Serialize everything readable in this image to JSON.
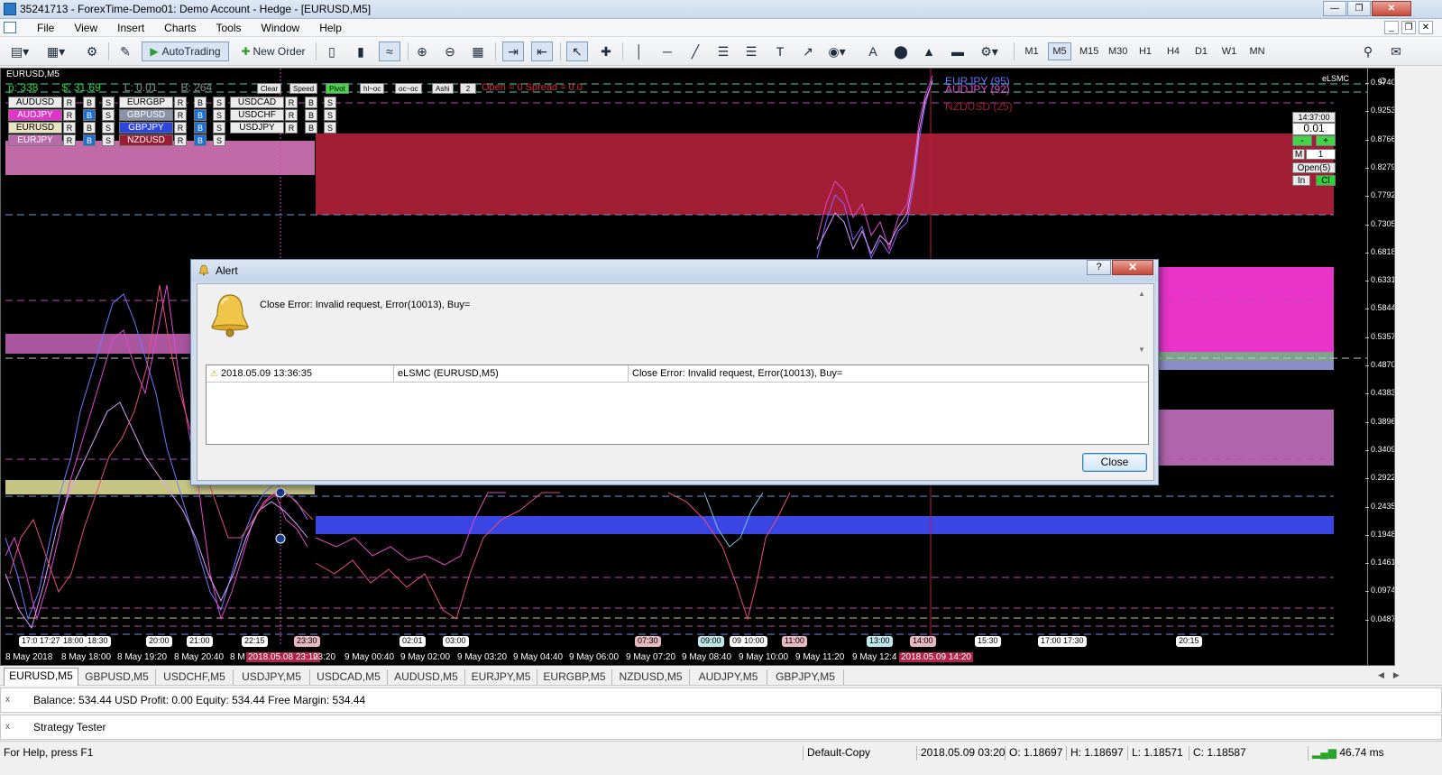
{
  "window": {
    "title": "35241713 - ForexTime-Demo01: Demo Account - Hedge - [EURUSD,M5]"
  },
  "menu": [
    "File",
    "View",
    "Insert",
    "Charts",
    "Tools",
    "Window",
    "Help"
  ],
  "toolbar": {
    "autotrading": "AutoTrading",
    "new_order": "New Order",
    "timeframes": [
      "M1",
      "M5",
      "M15",
      "M30",
      "H1",
      "H4",
      "D1",
      "W1",
      "MN"
    ],
    "active_timeframe": "M5"
  },
  "chart": {
    "symbol": "EURUSD,M5",
    "indicator": "eLSMC",
    "stats": {
      "p": "p: 338",
      "s": "$: 31.69",
      "l": "L: 0.01",
      "b": "B: 264"
    },
    "controls": [
      "Clear",
      "Speed",
      "Pivot",
      "hl~oc",
      "oc~oc",
      "Ashi"
    ],
    "ashi_value": "2",
    "open_spread": "Open = 0  Spread = 0.0",
    "pairs": [
      [
        "AUDUSD",
        "EURGBP",
        "USDCAD"
      ],
      [
        "AUDJPY",
        "GBPUSD",
        "USDCHF"
      ],
      [
        "EURUSD",
        "GBPJPY",
        "USDJPY"
      ],
      [
        "EURJPY",
        "NZDUSD",
        ""
      ]
    ],
    "button_letters": [
      "R",
      "B",
      "S"
    ],
    "legend_top": [
      "EURJPY (95)",
      "AUDJPY (92)",
      "NZDUSD (25)"
    ],
    "side_panel": {
      "time": "14:37:00",
      "lot": "0.01",
      "minus": "-",
      "plus": "+",
      "m_label": "M",
      "m_value": "1",
      "open": "Open(5)",
      "in": "In",
      "cl": "Cl"
    },
    "yaxis": [
      "0.97400",
      "0.92530",
      "0.87660",
      "0.82790",
      "0.77920",
      "0.73050",
      "0.68180",
      "0.63310",
      "0.58440",
      "0.53570",
      "0.48700",
      "0.43830",
      "0.38960",
      "0.34090",
      "0.29220",
      "0.24350",
      "0.19480",
      "0.14610",
      "0.09740",
      "0.04870"
    ],
    "time_markers": [
      {
        "t": "17:0",
        "c": "w"
      },
      {
        "t": "17:27",
        "c": "w"
      },
      {
        "t": "18:00",
        "c": "w"
      },
      {
        "t": "18:30",
        "c": "w"
      },
      {
        "t": "20:00",
        "c": "w"
      },
      {
        "t": "21:00",
        "c": "w"
      },
      {
        "t": "22:15",
        "c": "w"
      },
      {
        "t": "23:30",
        "c": "r"
      },
      {
        "t": "02:01",
        "c": "w"
      },
      {
        "t": "03:00",
        "c": "w"
      },
      {
        "t": "07:30",
        "c": "r"
      },
      {
        "t": "09:00",
        "c": "c"
      },
      {
        "t": "09",
        "c": "w"
      },
      {
        "t": "10:00",
        "c": "w"
      },
      {
        "t": "11:00",
        "c": "r"
      },
      {
        "t": "13:00",
        "c": "c"
      },
      {
        "t": "14:00",
        "c": "r"
      },
      {
        "t": "15:30",
        "c": "w"
      },
      {
        "t": "17:00",
        "c": "w"
      },
      {
        "t": "17:30",
        "c": "w"
      },
      {
        "t": "20:15",
        "c": "w"
      }
    ],
    "xaxis": [
      "8 May 2018",
      "8 May 18:00",
      "8 May 19:20",
      "8 May 20:40",
      "8 M",
      "2018.05.08 23:10",
      "23:20",
      "9 May 00:40",
      "9 May 02:00",
      "9 May 03:20",
      "9 May 04:40",
      "9 May 06:00",
      "9 May 07:20",
      "9 May 08:40",
      "9 May 10:00",
      "9 May 11:20",
      "9 May 12:4",
      "2018.05.09 14:20"
    ]
  },
  "tabs": [
    "EURUSD,M5",
    "GBPUSD,M5",
    "USDCHF,M5",
    "USDJPY,M5",
    "USDCAD,M5",
    "AUDUSD,M5",
    "EURJPY,M5",
    "EURGBP,M5",
    "NZDUSD,M5",
    "AUDJPY,M5",
    "GBPJPY,M5"
  ],
  "terminal": {
    "x": "x",
    "balance": "Balance: 534.44 USD  Profit: 0.00  Equity: 534.44  Free Margin: 534.44"
  },
  "tester": {
    "x": "x",
    "label": "Strategy Tester"
  },
  "status": {
    "help": "For Help, press F1",
    "profile": "Default-Copy",
    "datetime": "2018.05.09 03:20",
    "open": "O: 1.18697",
    "high": "H: 1.18697",
    "low": "L: 1.18571",
    "close": "C: 1.18587",
    "ping": "46.74 ms"
  },
  "alert": {
    "title": "Alert",
    "help": "?",
    "message": "Close Error: Invalid request, Error(10013), Buy=",
    "log": {
      "time": "2018.05.09 13:36:35",
      "source": "eLSMC (EURUSD,M5)",
      "message": "Close Error: Invalid request, Error(10013), Buy="
    },
    "close_label": "Close"
  },
  "colors": {
    "accent": "#2b7ac9",
    "chart_bg": "#000000",
    "band_red": "#a11e35",
    "band_magenta": "#e834c8",
    "band_blue": "#3a45e4"
  }
}
